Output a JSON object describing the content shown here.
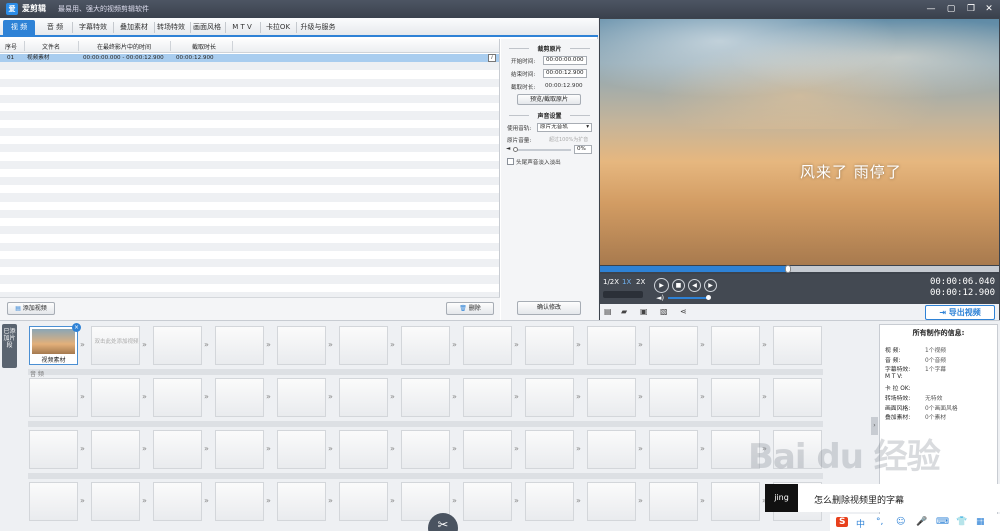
{
  "app": {
    "logo": "爱",
    "name": "爱剪辑",
    "slogan": "最易用、强大的视频剪辑软件",
    "controls": [
      "—",
      "▢",
      "❐",
      "✕"
    ]
  },
  "tabs": [
    {
      "label": "视 频",
      "active": true
    },
    {
      "label": "音 频"
    },
    {
      "label": "字幕特效"
    },
    {
      "label": "叠加素材"
    },
    {
      "label": "转场特效"
    },
    {
      "label": "画面风格"
    },
    {
      "label": "M T V"
    },
    {
      "label": "卡拉OK"
    },
    {
      "label": "升级与服务"
    }
  ],
  "list": {
    "headers": [
      "序号",
      "文件名",
      "在最终影片中的时间",
      "截取时长"
    ],
    "rows": [
      {
        "no": "01",
        "name": "视频素材",
        "time": "00:00:00.000 - 00:00:12.900",
        "duration": "00:00:12.900"
      }
    ],
    "info_icon": "i"
  },
  "footer": {
    "add_video": "添加视频",
    "delete": "删除",
    "confirm": "确认修改"
  },
  "settings": {
    "clip_title": "裁剪原片",
    "start_label": "开始时间:",
    "start_value": "00:00:00.000",
    "end_label": "结束时间:",
    "end_value": "00:00:12.900",
    "dur_label": "截取时长:",
    "dur_value": "00:00:12.900",
    "preview_btn": "预览/截取原片",
    "audio_title": "声音设置",
    "track_label": "使用音轨:",
    "track_value": "原片无音轨",
    "volume_label": "原片音量:",
    "volume_hint": "超过100%为扩音",
    "volume_value": "0%",
    "fade_label": "头尾声音淡入淡出"
  },
  "preview": {
    "caption": "风来了 雨停了",
    "speeds": [
      "1/2X",
      "1X",
      "2X"
    ],
    "time_current": "00:00:06.040",
    "time_total": "00:00:12.900",
    "export": "导出视频",
    "progress": 0.47
  },
  "timeline": {
    "side_tab": "已添加片段",
    "clip_name": "视频素材",
    "add_hint": "双击此处添加视频",
    "audio_label": "音 频"
  },
  "info": {
    "title": "所有制作的信息:",
    "rows": [
      {
        "k": "视  频:",
        "v": "1个视频"
      },
      {
        "k": "音  频:",
        "v": "0个音频"
      },
      {
        "k": "字幕特效:",
        "v": "1个字幕"
      },
      {
        "k": "M  T  V:",
        "v": ""
      },
      {
        "k": "卡 拉 OK:",
        "v": ""
      },
      {
        "k": "转场特效:",
        "v": "无特效"
      },
      {
        "k": "画面风格:",
        "v": "0个画面风格"
      },
      {
        "k": "叠加素材:",
        "v": "0个素材"
      }
    ]
  },
  "overlay": {
    "black_text": "jing",
    "text": "怎么删除视频里的字幕"
  },
  "ime": [
    "S",
    "中",
    "°,",
    "☺",
    "🎤",
    "⌨",
    "👕",
    "▦"
  ],
  "watermark": "Bai du 经验"
}
